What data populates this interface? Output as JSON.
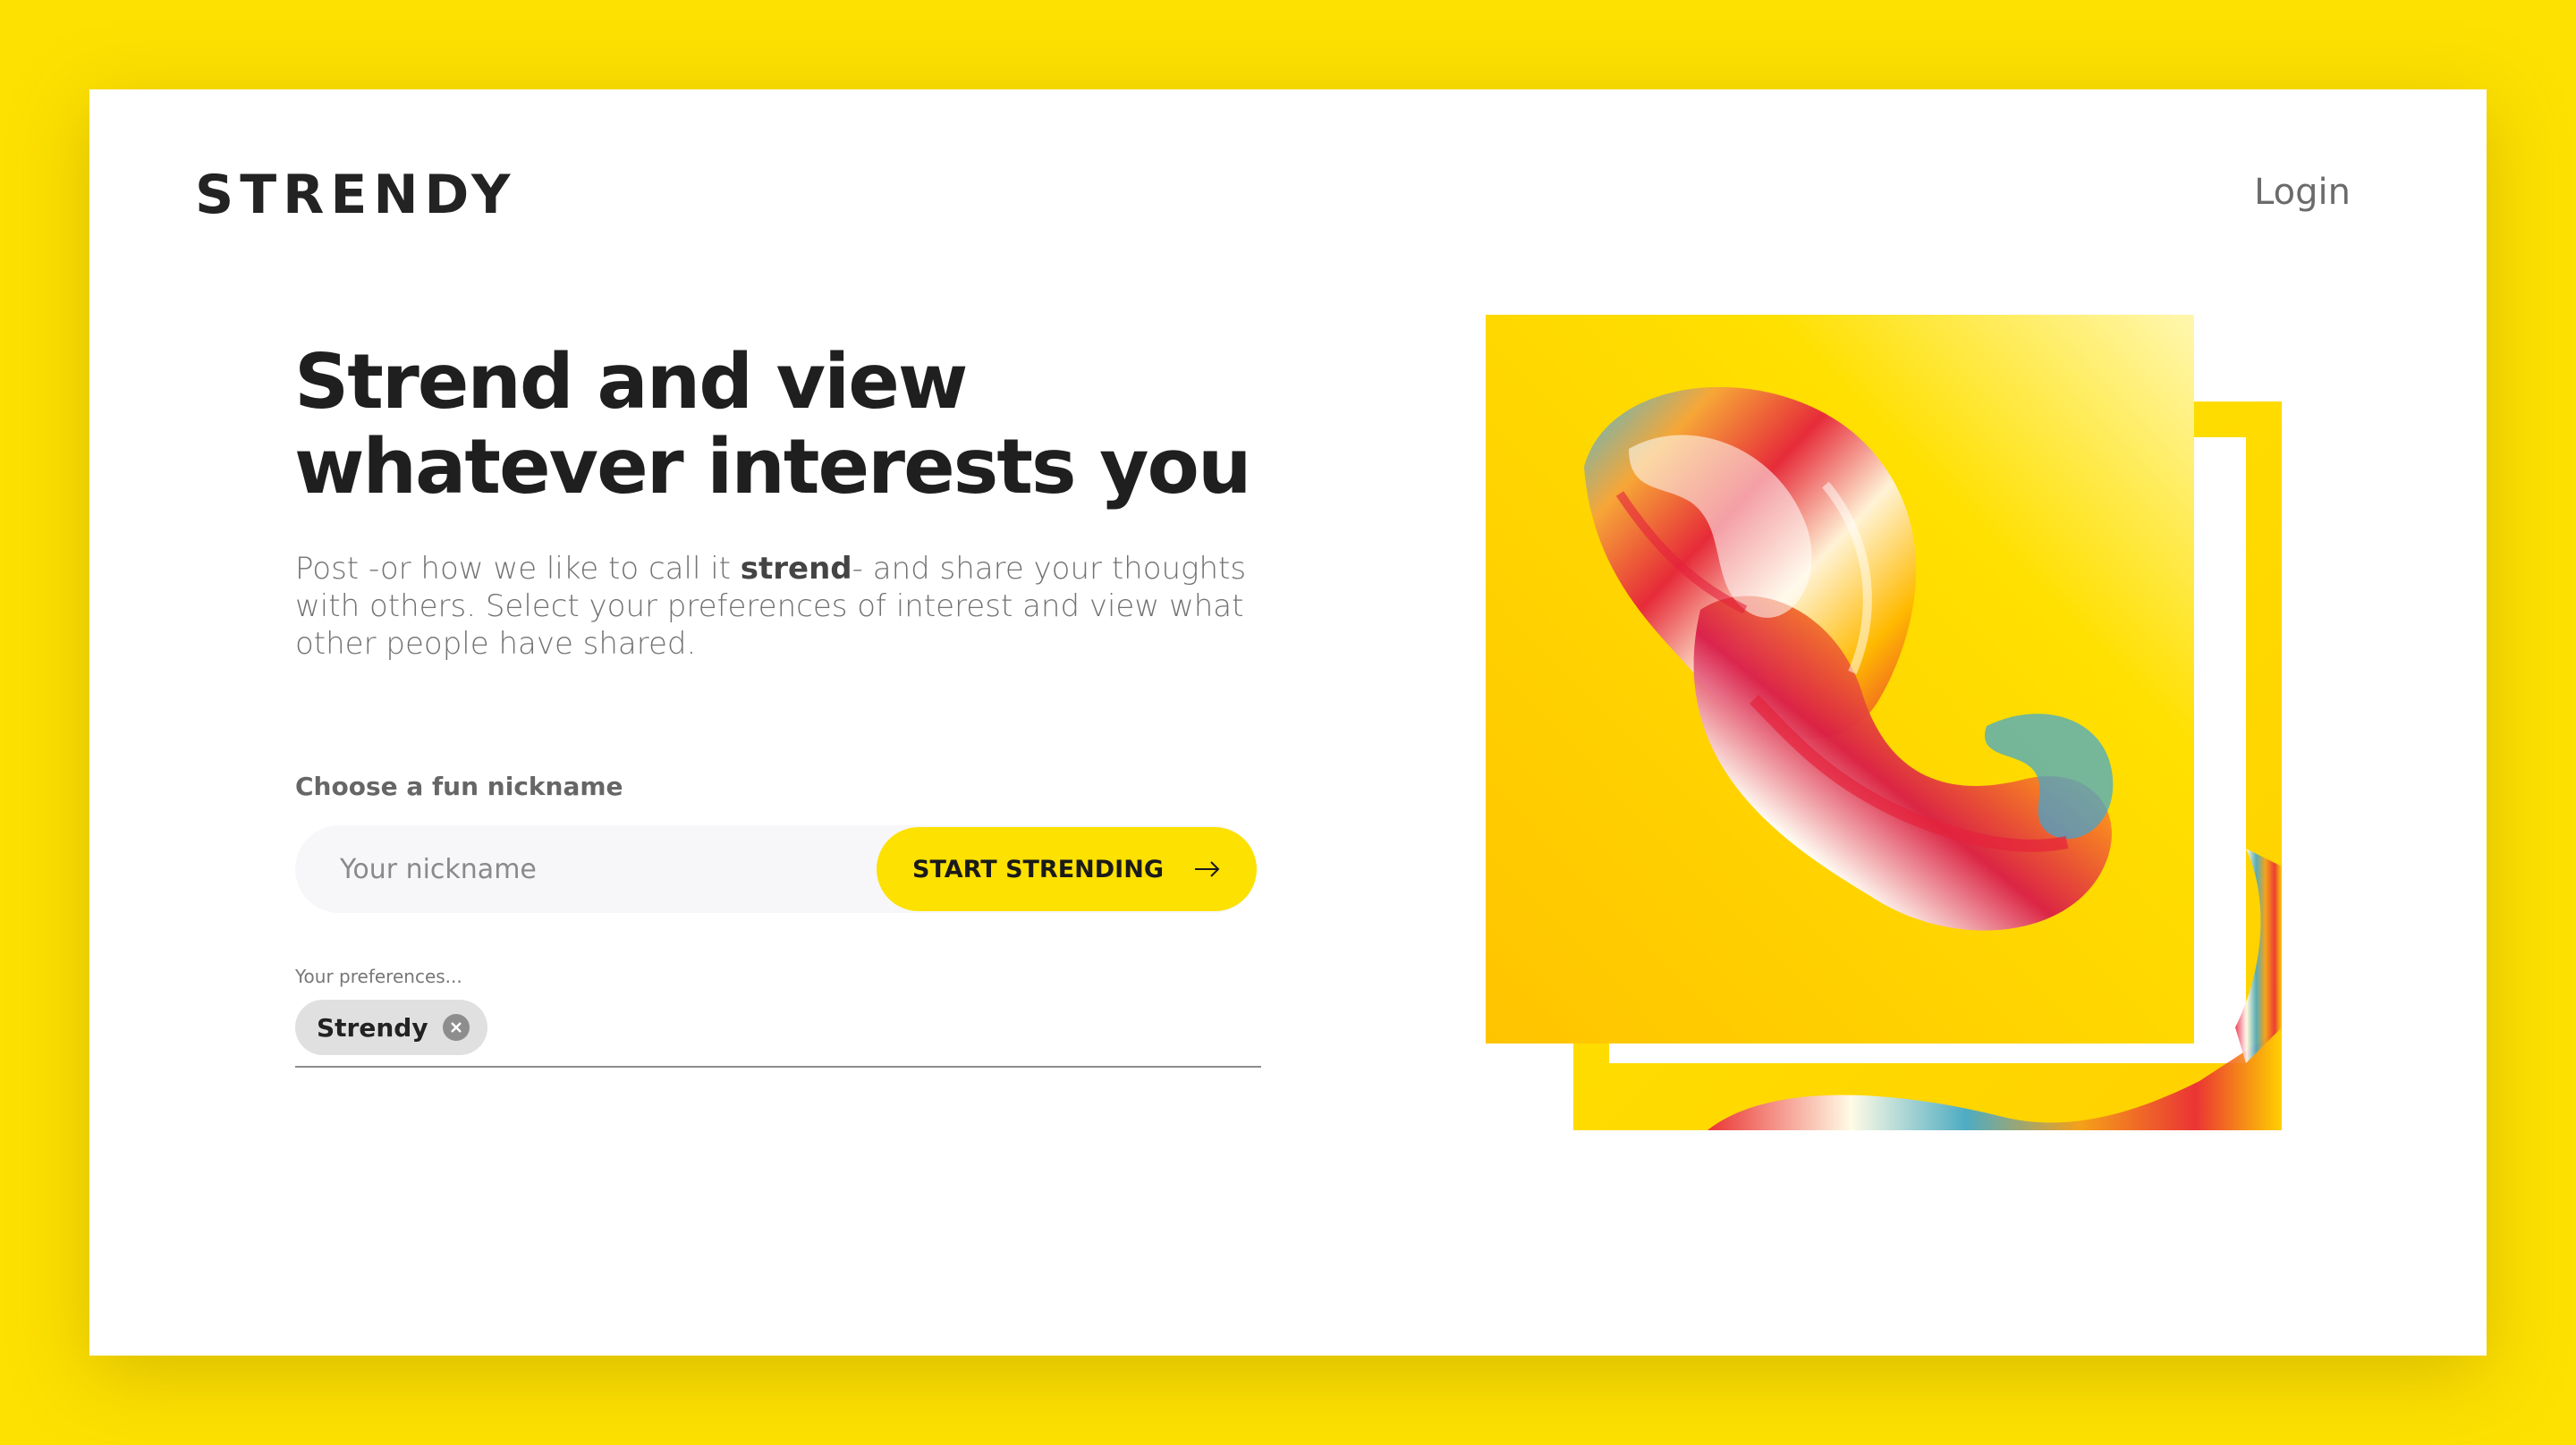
{
  "brand": {
    "name": "STRENDY"
  },
  "header": {
    "login": "Login"
  },
  "hero": {
    "title_line1": "Strend and view",
    "title_line2": "whatever interests you",
    "intro_before": "Post -or how we like to call it ",
    "intro_bold": "strend",
    "intro_after": "- and share your thoughts with others. Select your preferences of interest and view what other people have shared."
  },
  "form": {
    "nickname_label": "Choose a fun nickname",
    "nickname_placeholder": "Your nickname",
    "nickname_value": "",
    "submit_label": "START STRENDING",
    "preferences_label": "Your preferences...",
    "preferences": [
      "Strendy"
    ]
  },
  "icons": {
    "submit": "arrow-right-icon",
    "chip_remove": "close-circle-icon"
  },
  "colors": {
    "accent": "#fde100",
    "text_dark": "#1f1f1f",
    "text_muted": "#727272",
    "input_bg": "#f7f7fa"
  }
}
